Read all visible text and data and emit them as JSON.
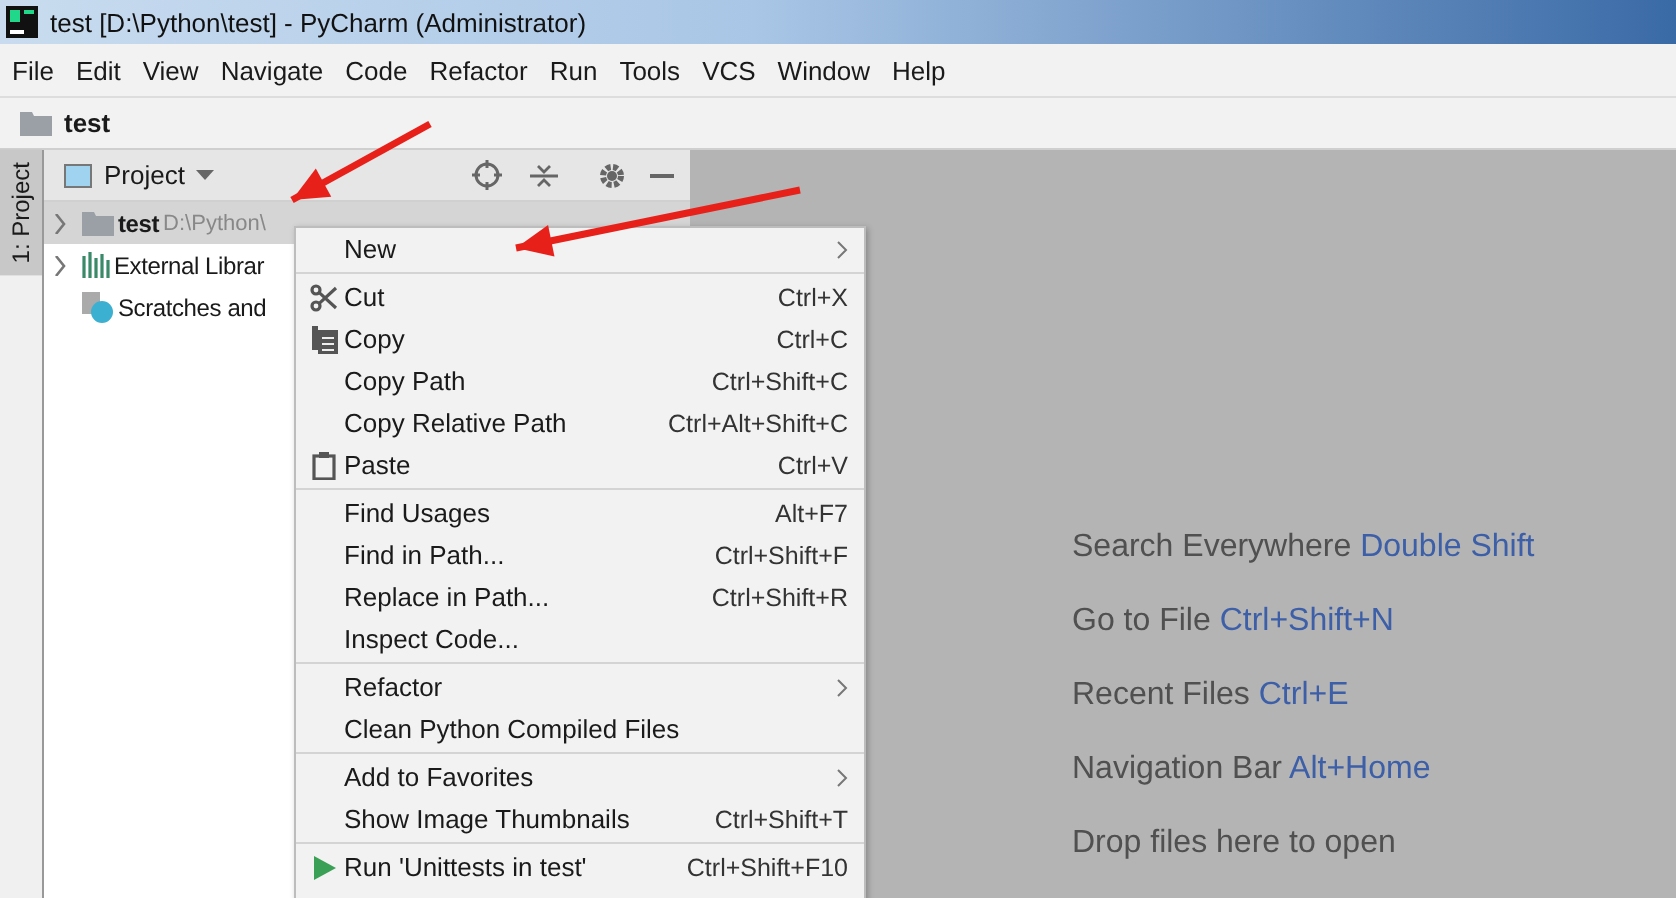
{
  "window": {
    "title": "test [D:\\Python\\test] - PyCharm (Administrator)"
  },
  "menu_bar": [
    "File",
    "Edit",
    "View",
    "Navigate",
    "Code",
    "Refactor",
    "Run",
    "Tools",
    "VCS",
    "Window",
    "Help"
  ],
  "navigation_bar": {
    "crumb": "test"
  },
  "side_tab": {
    "label": "1: Project",
    "selected": true
  },
  "project_panel": {
    "title": "Project",
    "tree": [
      {
        "name": "test",
        "path": "D:\\Python\\",
        "kind": "folder",
        "expanded": false
      },
      {
        "name": "External Librar",
        "kind": "library",
        "expanded": false
      },
      {
        "name": "Scratches and",
        "kind": "scratches"
      }
    ]
  },
  "context_menu": [
    [
      {
        "label": "New",
        "submenu": true
      }
    ],
    [
      {
        "label": "Cut",
        "shortcut": "Ctrl+X",
        "kind": "cut"
      },
      {
        "label": "Copy",
        "shortcut": "Ctrl+C",
        "kind": "copy"
      },
      {
        "label": "Copy Path",
        "shortcut": "Ctrl+Shift+C"
      },
      {
        "label": "Copy Relative Path",
        "shortcut": "Ctrl+Alt+Shift+C"
      },
      {
        "label": "Paste",
        "shortcut": "Ctrl+V",
        "kind": "paste"
      }
    ],
    [
      {
        "label": "Find Usages",
        "shortcut": "Alt+F7"
      },
      {
        "label": "Find in Path...",
        "shortcut": "Ctrl+Shift+F"
      },
      {
        "label": "Replace in Path...",
        "shortcut": "Ctrl+Shift+R"
      },
      {
        "label": "Inspect Code..."
      }
    ],
    [
      {
        "label": "Refactor",
        "submenu": true
      },
      {
        "label": "Clean Python Compiled Files"
      }
    ],
    [
      {
        "label": "Add to Favorites",
        "submenu": true
      },
      {
        "label": "Show Image Thumbnails",
        "shortcut": "Ctrl+Shift+T"
      }
    ],
    [
      {
        "label": "Run 'Unittests in test'",
        "shortcut": "Ctrl+Shift+F10",
        "kind": "run"
      }
    ]
  ],
  "editor_hints": [
    {
      "text": "Search Everywhere",
      "shortcut": "Double Shift"
    },
    {
      "text": "Go to File",
      "shortcut": "Ctrl+Shift+N"
    },
    {
      "text": "Recent Files",
      "shortcut": "Ctrl+E"
    },
    {
      "text": "Navigation Bar",
      "shortcut": "Alt+Home"
    },
    {
      "text": "Drop files here to open"
    }
  ]
}
